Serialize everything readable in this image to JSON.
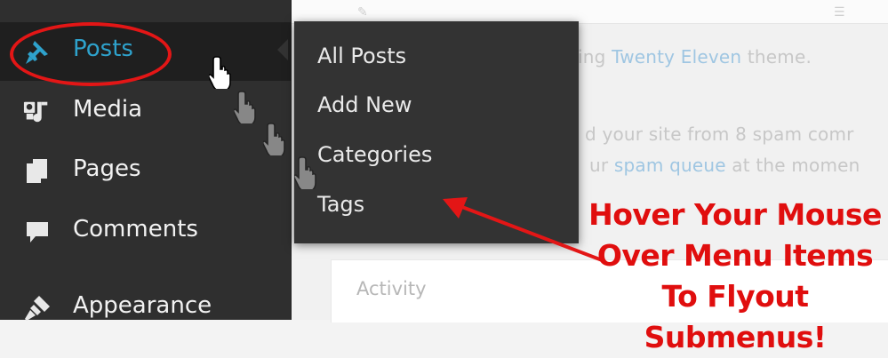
{
  "background": {
    "theme_line": {
      "prefix": "ing ",
      "link": "Twenty Eleven",
      "suffix": " theme."
    },
    "spam_line1": "d your site from 8 spam comr",
    "spam_line2": {
      "prefix": "ur ",
      "link": "spam queue",
      "suffix": " at the momen"
    },
    "activity_title": "Activity"
  },
  "sidebar": {
    "items": [
      {
        "label": "Posts",
        "icon": "pin-icon"
      },
      {
        "label": "Media",
        "icon": "media-icon"
      },
      {
        "label": "Pages",
        "icon": "pages-icon"
      },
      {
        "label": "Comments",
        "icon": "comment-icon"
      },
      {
        "label": "Appearance",
        "icon": "paintbrush-icon"
      }
    ]
  },
  "flyout": {
    "items": [
      "All Posts",
      "Add New",
      "Categories",
      "Tags"
    ]
  },
  "annotation": {
    "line1": "Hover Your Mouse",
    "line2": "Over Menu Items",
    "line3": "To Flyout Submenus!"
  },
  "colors": {
    "accent_blue": "#2ea2cc",
    "annotation_red": "#e31616",
    "sidebar_bg": "#2f2f2f"
  }
}
